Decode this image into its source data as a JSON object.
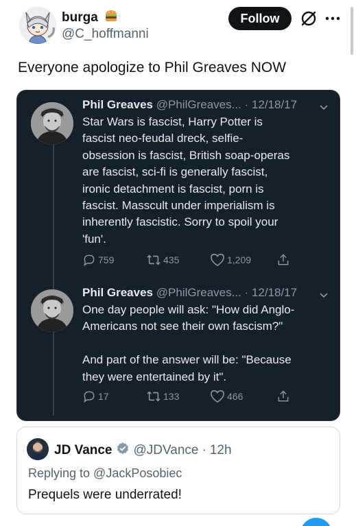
{
  "header": {
    "display_name": "burga",
    "name_emoji_icon": "hamburger-icon",
    "handle": "@C_hoffmanni",
    "follow_label": "Follow"
  },
  "tweet": {
    "text": "Everyone apologize to Phil Greaves NOW"
  },
  "embedded_thread": {
    "background": "#15202b",
    "posts": [
      {
        "name": "Phil Greaves",
        "handle": "@PhilGreaves...",
        "separator": "·",
        "date": "12/18/17",
        "body": "Star Wars is fascist, Harry Potter is\nfascist neo-feudal dreck, selfie-\nobsession is fascist, British soap-operas\nare fascist, sci-fi is generally fascist,\nironic detachment is fascist, porn is\nfascist. Masscult under imperialism is\ninherently fascistic. Sorry to spoil your\n'fun'.",
        "replies": "759",
        "retweets": "435",
        "likes": "1,209"
      },
      {
        "name": "Phil Greaves",
        "handle": "@PhilGreaves...",
        "separator": "·",
        "date": "12/18/17",
        "body": "One day people will ask: \"How did Anglo-\nAmericans not see their own fascism?\"\n\nAnd part of the answer will be: \"Because\nthey were entertained by it\".",
        "replies": "17",
        "retweets": "133",
        "likes": "466"
      }
    ]
  },
  "quoted_reply": {
    "name": "JD Vance",
    "verified_icon": "verified-badge-icon",
    "handle": "@JDVance",
    "separator": "·",
    "time": "12h",
    "replying_to": "Replying to @JackPosobiec",
    "text": "Prequels were underrated!"
  },
  "colors": {
    "accent": "#1d9bf0",
    "dark_text": "#e7e9ea",
    "dark_muted": "#8b98a5",
    "muted": "#536471"
  }
}
